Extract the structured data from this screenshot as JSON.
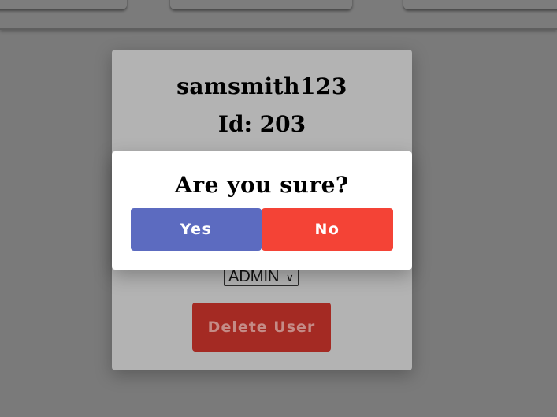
{
  "user_card": {
    "username": "samsmith123",
    "id_text": "Id: 203",
    "role_select": {
      "selected": "ADMIN",
      "chevron_icon": "chevron-down-icon"
    },
    "delete_button_label": "Delete User"
  },
  "dialog": {
    "title": "Are you sure?",
    "yes_label": "Yes",
    "no_label": "No"
  },
  "colors": {
    "yes_button": "#5c6bc0",
    "no_button": "#f44336",
    "delete_button": "#a42a23",
    "overlay": "#7a7a7a"
  }
}
